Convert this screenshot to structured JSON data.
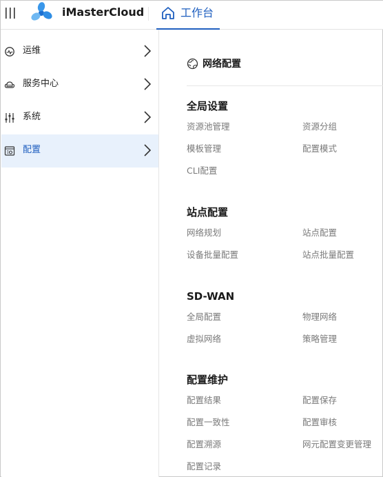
{
  "header": {
    "brand": "iMasterCloud",
    "active_tab": "工作台",
    "colors": {
      "accent": "#1f5fbf",
      "logo_blue": "#2f8de4",
      "logo_light": "#6fb8f2"
    }
  },
  "sidebar": {
    "items": [
      {
        "label": "运维",
        "icon": "monitor-icon",
        "active": false
      },
      {
        "label": "服务中心",
        "icon": "cloud-icon",
        "active": false
      },
      {
        "label": "系统",
        "icon": "sliders-icon",
        "active": false
      },
      {
        "label": "配置",
        "icon": "config-icon",
        "active": true
      }
    ]
  },
  "main": {
    "title": "网络配置",
    "title_icon": "globe-icon",
    "sections": [
      {
        "title": "全局设置",
        "links": [
          "资源池管理",
          "资源分组",
          "模板管理",
          "配置模式",
          "CLI配置"
        ]
      },
      {
        "title": "站点配置",
        "links": [
          "网络规划",
          "站点配置",
          "设备批量配置",
          "站点批量配置"
        ]
      },
      {
        "title": "SD-WAN",
        "links": [
          "全局配置",
          "物理网络",
          "虚拟网络",
          "策略管理"
        ]
      },
      {
        "title": "配置维护",
        "links": [
          "配置结果",
          "配置保存",
          "配置一致性",
          "配置审核",
          "配置溯源",
          "网元配置变更管理",
          "配置记录"
        ]
      }
    ]
  }
}
